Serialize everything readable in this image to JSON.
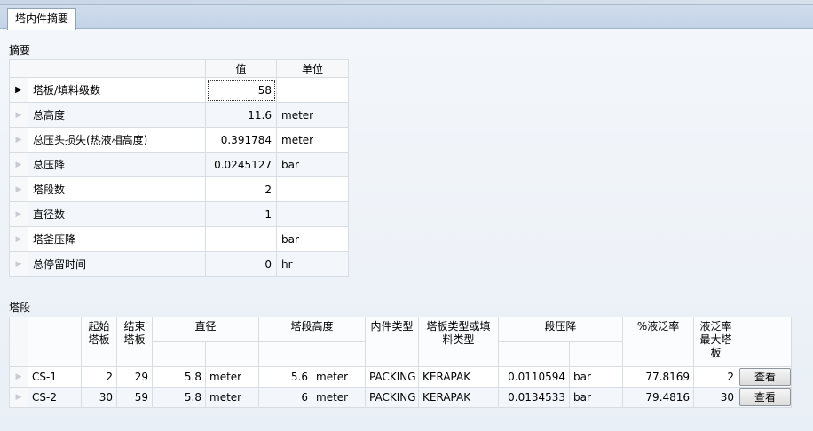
{
  "tab": {
    "label": "塔内件摘要"
  },
  "summary": {
    "title": "摘要",
    "headers": {
      "value": "值",
      "unit": "单位"
    },
    "rows": [
      {
        "name": "塔板/填料级数",
        "value": "58",
        "unit": ""
      },
      {
        "name": "总高度",
        "value": "11.6",
        "unit": "meter"
      },
      {
        "name": "总压头损失(热液相高度)",
        "value": "0.391784",
        "unit": "meter"
      },
      {
        "name": "总压降",
        "value": "0.0245127",
        "unit": "bar"
      },
      {
        "name": "塔段数",
        "value": "2",
        "unit": ""
      },
      {
        "name": "直径数",
        "value": "1",
        "unit": ""
      },
      {
        "name": "塔釜压降",
        "value": "",
        "unit": "bar"
      },
      {
        "name": "总停留时间",
        "value": "0",
        "unit": "hr"
      }
    ]
  },
  "sections": {
    "title": "塔段",
    "headers": {
      "start_tray": "起始塔板",
      "end_tray": "结束塔板",
      "diameter": "直径",
      "height": "塔段高度",
      "internal_type": "内件类型",
      "tray_pack_type": "塔板类型或填料类型",
      "pressure_drop": "段压降",
      "flood": "%液泛率",
      "flood_max_tray": "液泛率最大塔板"
    },
    "rows": [
      {
        "name": "CS-1",
        "start": "2",
        "end": "29",
        "diameter": "5.8",
        "diameter_unit": "meter",
        "height": "5.6",
        "height_unit": "meter",
        "internal_type": "PACKING",
        "pack_type": "KERAPAK",
        "dp": "0.0110594",
        "dp_unit": "bar",
        "flood": "77.8169",
        "flood_tray": "2",
        "button": "查看"
      },
      {
        "name": "CS-2",
        "start": "30",
        "end": "59",
        "diameter": "5.8",
        "diameter_unit": "meter",
        "height": "6",
        "height_unit": "meter",
        "internal_type": "PACKING",
        "pack_type": "KERAPAK",
        "dp": "0.0134533",
        "dp_unit": "bar",
        "flood": "79.4816",
        "flood_tray": "30",
        "button": "查看"
      }
    ]
  }
}
